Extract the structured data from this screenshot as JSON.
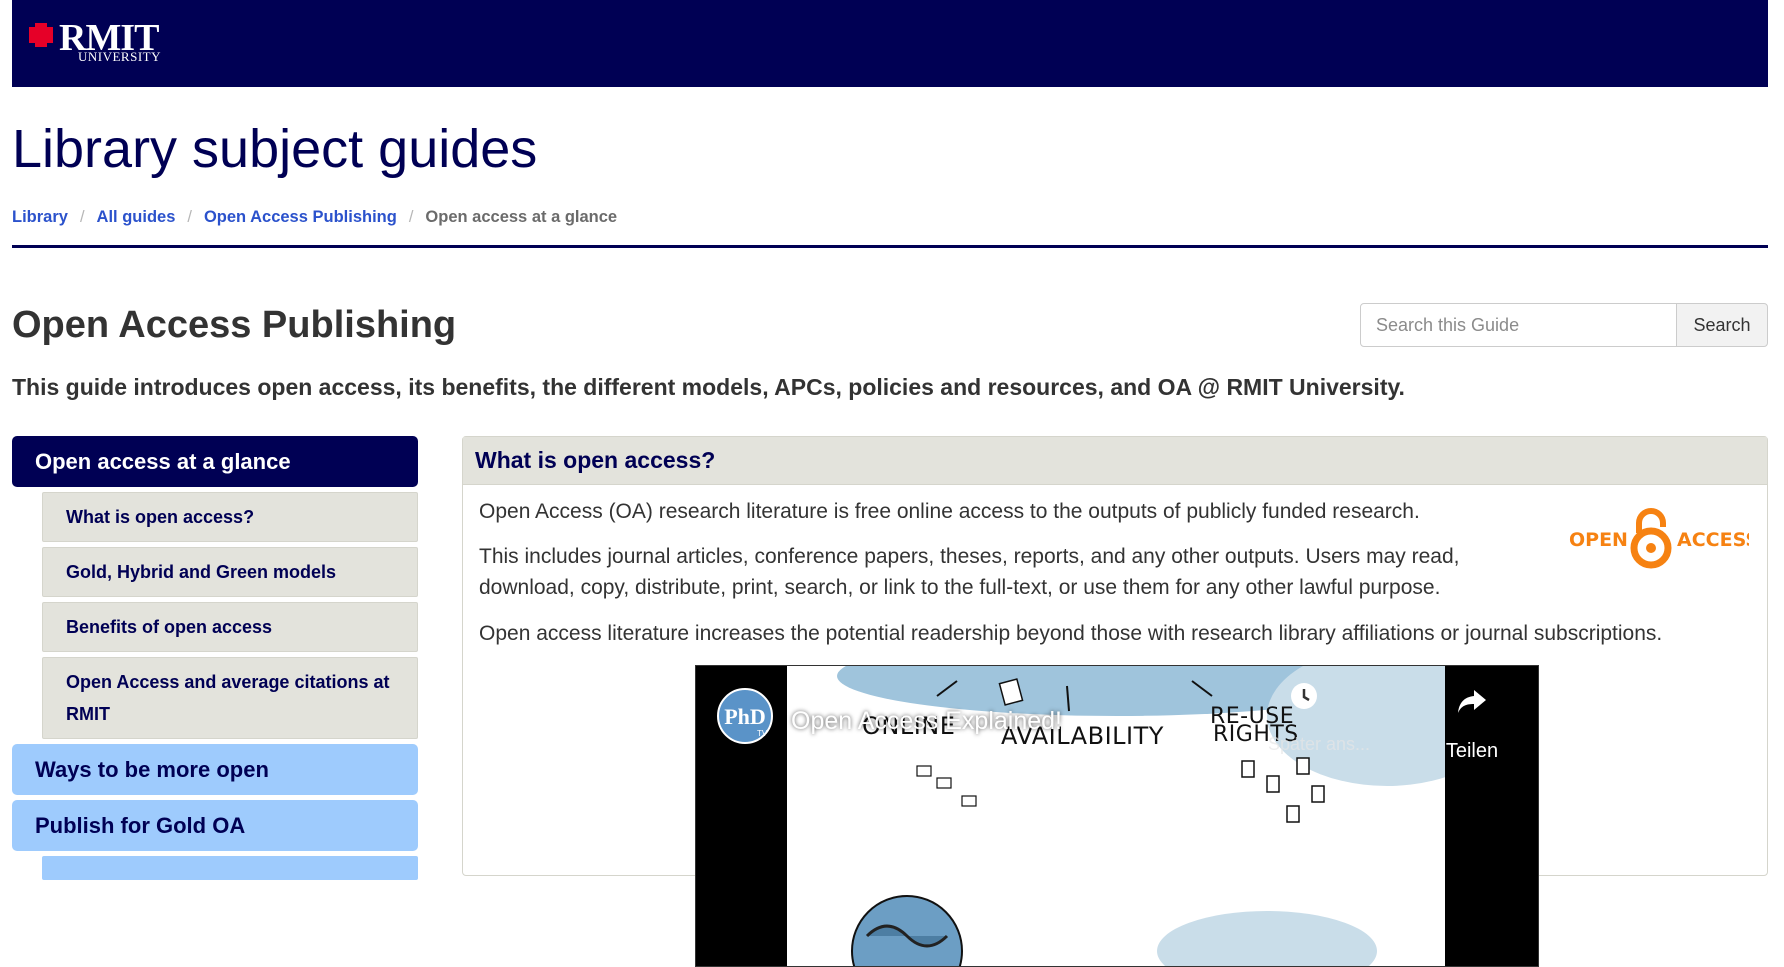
{
  "header": {
    "logo_word": "RMIT",
    "logo_sub": "UNIVERSITY",
    "brand_color": "#000054"
  },
  "site_title": "Library subject guides",
  "breadcrumb": [
    {
      "label": "Library"
    },
    {
      "label": "All guides"
    },
    {
      "label": "Open Access Publishing"
    },
    {
      "label": "Open access at a glance"
    }
  ],
  "guide": {
    "title": "Open Access Publishing",
    "description": "This guide introduces open access, its benefits, the different models, APCs, policies and resources, and OA @ RMIT University."
  },
  "search": {
    "placeholder": "Search this Guide",
    "button_label": "Search"
  },
  "sidenav": {
    "active": {
      "label": "Open access at a glance"
    },
    "sub_items": [
      {
        "label": "What is open access?"
      },
      {
        "label": "Gold, Hybrid and Green models"
      },
      {
        "label": "Benefits of open access"
      },
      {
        "label": "Open Access and average citations at RMIT"
      }
    ],
    "items": [
      {
        "label": "Ways to be more open"
      },
      {
        "label": "Publish for Gold OA"
      }
    ]
  },
  "panel": {
    "heading": "What is open access?",
    "paragraphs": [
      "Open Access (OA) research literature is free online access to the outputs of publicly funded research.",
      "This includes journal articles, conference papers, theses, reports, and any other outputs. Users may read, download, copy, distribute, print, search, or link to the full-text, or use them for any other lawful purpose.",
      "Open access literature increases the potential readership beyond those with research library affiliations or journal subscriptions."
    ],
    "oa_logo": {
      "left": "OPEN",
      "right": "ACCESS",
      "color": "#f68212",
      "icon": "open-lock-icon"
    }
  },
  "video": {
    "title": "Open Access Explained!",
    "watch_later_label": "Später ans...",
    "share_label": "Teilen",
    "sketch_words": [
      "ONLINE",
      "AVAILABILITY",
      "RE-USE",
      "RIGHTS"
    ]
  }
}
